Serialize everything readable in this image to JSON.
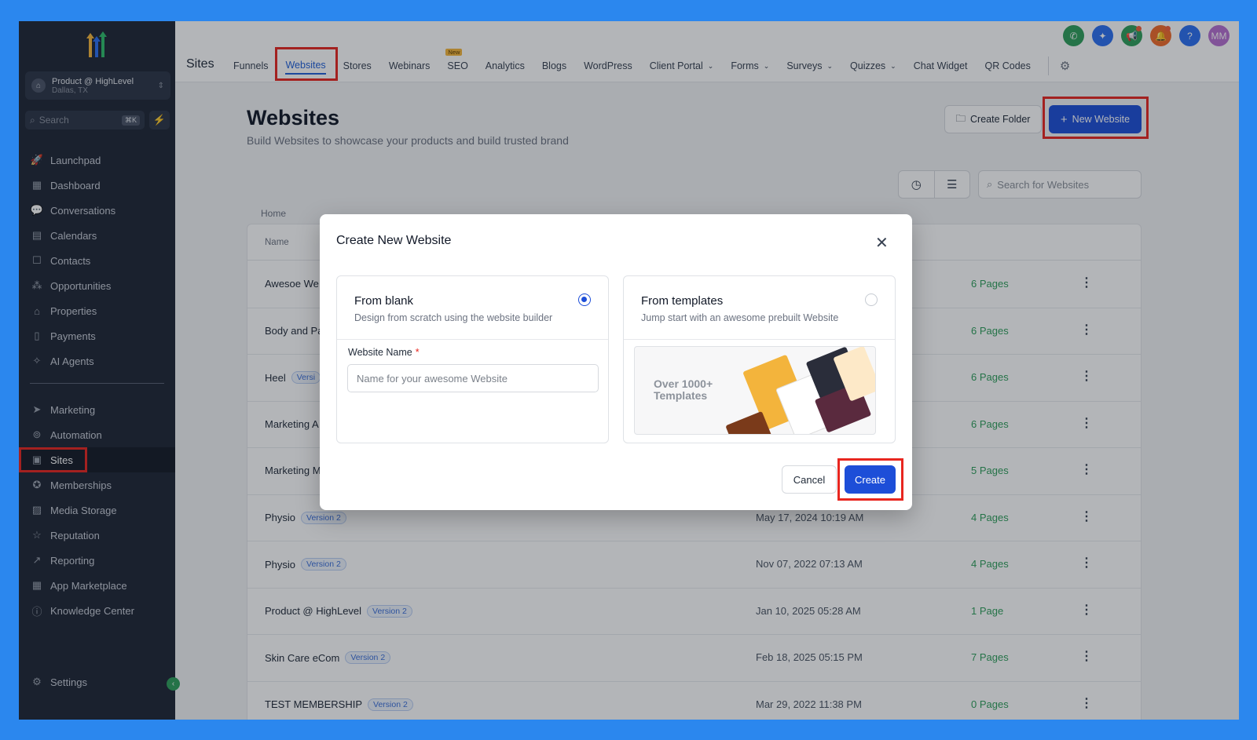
{
  "colors": {
    "accent": "#1d4ed8",
    "highlight": "#e8261f",
    "sidebar": "#1e2534",
    "pages_green": "#2e9e5a",
    "frame_bg": "#2b87ee"
  },
  "sidebar": {
    "account": {
      "name": "Product @ HighLevel",
      "location": "Dallas, TX"
    },
    "search": {
      "placeholder": "Search",
      "shortcut": "⌘K"
    },
    "items": [
      {
        "label": "Launchpad",
        "icon": "rocket-icon"
      },
      {
        "label": "Dashboard",
        "icon": "grid-icon"
      },
      {
        "label": "Conversations",
        "icon": "chat-icon"
      },
      {
        "label": "Calendars",
        "icon": "calendar-icon"
      },
      {
        "label": "Contacts",
        "icon": "contacts-icon"
      },
      {
        "label": "Opportunities",
        "icon": "opportunities-icon"
      },
      {
        "label": "Properties",
        "icon": "home-icon"
      },
      {
        "label": "Payments",
        "icon": "receipt-icon"
      },
      {
        "label": "AI Agents",
        "icon": "sparkle-icon"
      },
      {
        "label": "Marketing",
        "icon": "send-icon"
      },
      {
        "label": "Automation",
        "icon": "automation-icon"
      },
      {
        "label": "Sites",
        "icon": "globe-icon"
      },
      {
        "label": "Memberships",
        "icon": "award-icon"
      },
      {
        "label": "Media Storage",
        "icon": "image-icon"
      },
      {
        "label": "Reputation",
        "icon": "star-icon"
      },
      {
        "label": "Reporting",
        "icon": "trend-icon"
      },
      {
        "label": "App Marketplace",
        "icon": "apps-icon"
      },
      {
        "label": "Knowledge Center",
        "icon": "info-icon"
      }
    ],
    "settings": "Settings"
  },
  "header": {
    "title": "Sites",
    "tabs": [
      {
        "label": "Funnels"
      },
      {
        "label": "Websites"
      },
      {
        "label": "Stores"
      },
      {
        "label": "Webinars"
      },
      {
        "label": "SEO",
        "badge": "New"
      },
      {
        "label": "Analytics"
      },
      {
        "label": "Blogs"
      },
      {
        "label": "WordPress"
      },
      {
        "label": "Client Portal"
      },
      {
        "label": "Forms"
      },
      {
        "label": "Surveys"
      },
      {
        "label": "Quizzes"
      },
      {
        "label": "Chat Widget"
      },
      {
        "label": "QR Codes"
      }
    ],
    "user_initials": "MM",
    "help": "?"
  },
  "main": {
    "title": "Websites",
    "subtitle": "Build Websites to showcase your products and build trusted brand",
    "create_folder": "Create Folder",
    "new_website": "New Website",
    "search_placeholder": "Search for Websites",
    "breadcrumb": "Home",
    "table": {
      "col_name": "Name",
      "rows": [
        {
          "name": "Awesoe We",
          "badge": "",
          "date": "",
          "pages": "6 Pages"
        },
        {
          "name": "Body and Pa",
          "badge": "",
          "date": "",
          "pages": "6 Pages"
        },
        {
          "name": "Heel",
          "badge": "Versi",
          "date": "",
          "pages": "6 Pages"
        },
        {
          "name": "Marketing A",
          "badge": "",
          "date": "",
          "pages": "6 Pages"
        },
        {
          "name": "Marketing M",
          "badge": "",
          "date": "",
          "pages": "5 Pages"
        },
        {
          "name": "Physio",
          "badge": "Version 2",
          "date": "May 17, 2024 10:19 AM",
          "pages": "4 Pages"
        },
        {
          "name": "Physio",
          "badge": "Version 2",
          "date": "Nov 07, 2022 07:13 AM",
          "pages": "4 Pages"
        },
        {
          "name": "Product @ HighLevel",
          "badge": "Version 2",
          "date": "Jan 10, 2025 05:28 AM",
          "pages": "1 Page"
        },
        {
          "name": "Skin Care eCom",
          "badge": "Version 2",
          "date": "Feb 18, 2025 05:15 PM",
          "pages": "7 Pages"
        },
        {
          "name": "TEST MEMBERSHIP",
          "badge": "Version 2",
          "date": "Mar 29, 2022 11:38 PM",
          "pages": "0 Pages"
        }
      ]
    }
  },
  "modal": {
    "title": "Create New Website",
    "blank": {
      "title": "From blank",
      "subtitle": "Design from scratch using the website builder",
      "name_label": "Website Name",
      "required_mark": "*",
      "name_placeholder": "Name for your awesome Website",
      "selected": true
    },
    "templates": {
      "title": "From templates",
      "subtitle": "Jump start with an awesome prebuilt Website",
      "banner": "Over 1000+ Templates",
      "selected": false
    },
    "cancel": "Cancel",
    "create": "Create"
  }
}
